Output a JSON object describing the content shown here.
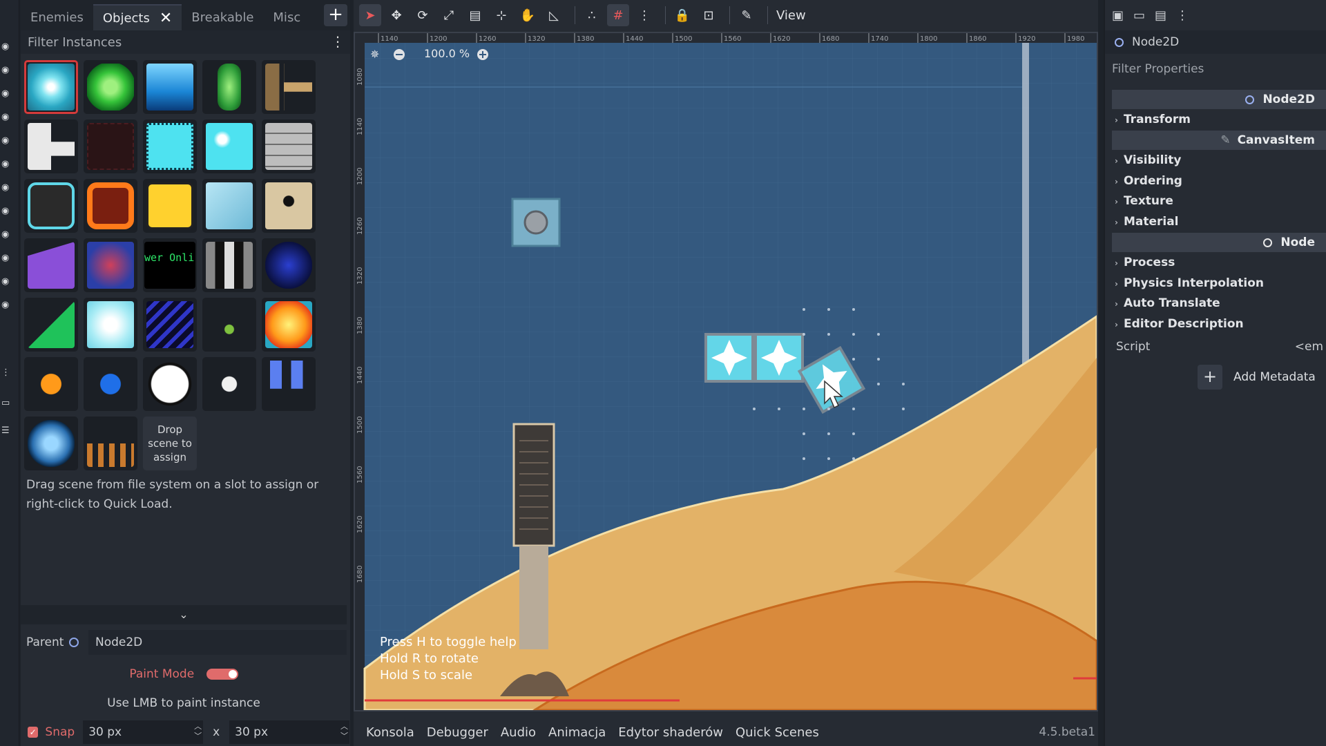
{
  "left_panel": {
    "tabs": [
      {
        "label": "Enemies"
      },
      {
        "label": "Objects"
      },
      {
        "label": "Breakable"
      },
      {
        "label": "Misc"
      }
    ],
    "filter_placeholder": "Filter Instances",
    "drop_slot_text": "Drop scene to assign",
    "help_text": "Drag scene from file system on a slot to assign or right-click to Quick Load.",
    "parent_label": "Parent",
    "parent_value": "Node2D",
    "paint_mode_label": "Paint Mode",
    "use_lmb_text": "Use LMB to paint instance",
    "snap_label": "Snap",
    "snap_x": "30 px",
    "snap_sep": "x",
    "snap_y": "30 px",
    "cell_text_power": "wer Onli"
  },
  "viewport": {
    "view_menu": "View",
    "zoom": "100.0 %",
    "ruler_labels": [
      "1140",
      "1200",
      "1260",
      "1320",
      "1380",
      "1440",
      "1500",
      "1560",
      "1620",
      "1680",
      "1740",
      "1800",
      "1860",
      "1920",
      "1980"
    ],
    "ruler_v_labels": [
      "1080",
      "1140",
      "1200",
      "1260",
      "1320",
      "1380",
      "1440",
      "1500",
      "1560",
      "1620",
      "1680"
    ],
    "help_overlay": [
      "Press H to toggle help",
      "Hold R to rotate",
      "Hold S to scale"
    ],
    "bottom_tabs": [
      "Konsola",
      "Debugger",
      "Audio",
      "Animacja",
      "Edytor shaderów",
      "Quick Scenes"
    ],
    "version": "4.5.beta1"
  },
  "inspector": {
    "node_name": "Node2D",
    "filter_placeholder": "Filter Properties",
    "sections": [
      {
        "title": "Node2D",
        "groups": [
          "Transform"
        ]
      },
      {
        "title": "CanvasItem",
        "groups": [
          "Visibility",
          "Ordering",
          "Texture",
          "Material"
        ]
      },
      {
        "title": "Node",
        "groups": [
          "Process",
          "Physics Interpolation",
          "Auto Translate",
          "Editor Description"
        ]
      }
    ],
    "script_label": "Script",
    "script_value": "<em",
    "add_metadata": "Add Metadata"
  },
  "colors": {
    "accent": "#e06b6b",
    "sky": "#34597f",
    "sand_light": "#e3b267",
    "sand_dark": "#d98a3c"
  }
}
